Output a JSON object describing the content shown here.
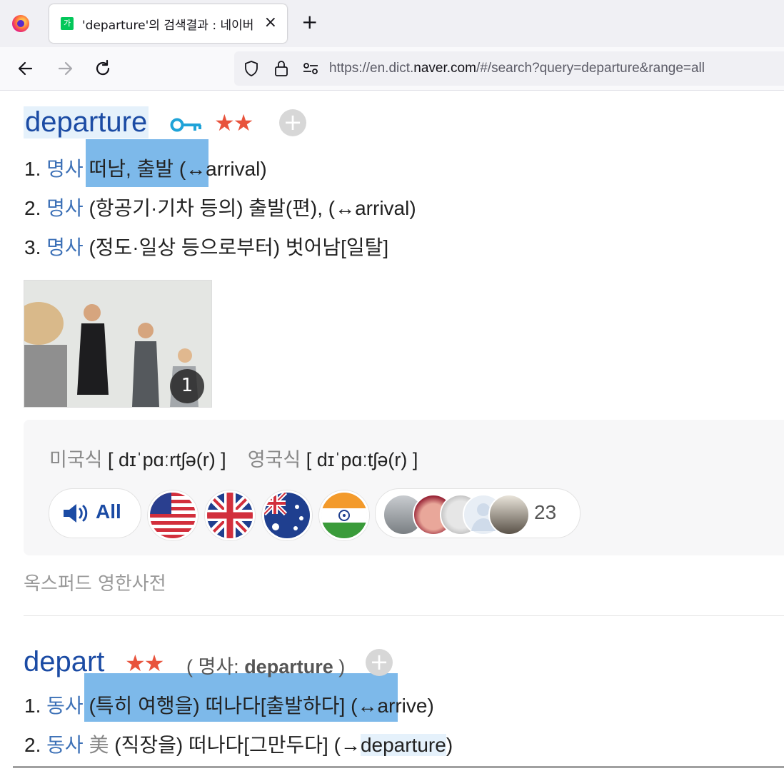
{
  "browser": {
    "tab_title": "'departure'의 검색결과 : 네이버",
    "favicon_text": "가",
    "close_label": "×",
    "new_tab_label": "+",
    "url_prefix": "https://en.dict.",
    "url_domain": "naver.com",
    "url_suffix": "/#/search?query=departure&range=all"
  },
  "entry1": {
    "headword": "departure",
    "stars": "★★",
    "add_label": "+",
    "definitions": [
      {
        "num": "1.",
        "pos": "명사",
        "text": " 떠남, 출발 (↔arrival)"
      },
      {
        "num": "2.",
        "pos": "명사",
        "text": " (항공기·기차 등의) 출발(편), (↔arrival)"
      },
      {
        "num": "3.",
        "pos": "명사",
        "text": " (정도·일상 등으로부터) 벗어남[일탈]"
      }
    ],
    "image_count": "1",
    "pronunciation": {
      "us_label": "미국식",
      "us_ipa": "[ dɪˈpɑːrtʃə(r) ]",
      "uk_label": "영국식",
      "uk_ipa": "[ dɪˈpɑːtʃə(r) ]",
      "all_label": "All",
      "user_count": "23"
    },
    "source": "옥스퍼드 영한사전"
  },
  "entry2": {
    "headword": "depart",
    "stars": "★★",
    "related_open": "( 명사: ",
    "related_word": "departure",
    "related_close": " )",
    "add_label": "+",
    "definitions": [
      {
        "num": "1.",
        "pos": "동사",
        "text": " (특히 여행을) 떠나다[출발하다] (↔arrive)"
      },
      {
        "num": "2.",
        "pos": "동사",
        "region": " 美",
        "text_before": " (직장을) 떠나다[그만두다] (→",
        "link": "departure",
        "text_after": ")"
      }
    ]
  },
  "colors": {
    "headword": "#1b4ba4",
    "pos": "#3d71b7",
    "stars": "#e8533c",
    "selection": "#7db9ea"
  }
}
